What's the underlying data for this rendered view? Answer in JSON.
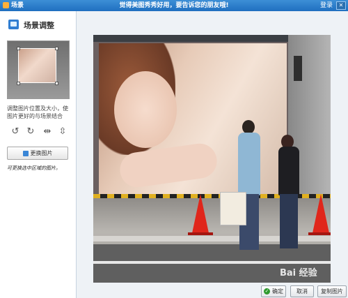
{
  "window": {
    "title": "场景",
    "slogan": "觉得美图秀秀好用，要告诉您的朋友哦!",
    "login_label": "登录",
    "close_glyph": "✕"
  },
  "sidebar": {
    "title": "场景调整",
    "hint": "调整图片位置及大小，使图片更好的与场景结合",
    "tools": [
      {
        "icon": "rotate-left-icon",
        "glyph": "↺"
      },
      {
        "icon": "rotate-right-icon",
        "glyph": "↻"
      },
      {
        "icon": "flip-horizontal-icon",
        "glyph": "⇹"
      },
      {
        "icon": "flip-vertical-icon",
        "glyph": "⇳"
      }
    ],
    "swap_button_label": "更换图片",
    "handwritten_note": "可更换选中区域的图片。"
  },
  "canvas": {
    "watermark": "Bai 经验"
  },
  "footer": {
    "ok_label": "确定",
    "cancel_label": "取消",
    "copy_label": "复制图片"
  },
  "colors": {
    "titlebar": "#1f6fc0",
    "accent": "#2f7dd1",
    "ok_check": "#2e9a2e"
  }
}
